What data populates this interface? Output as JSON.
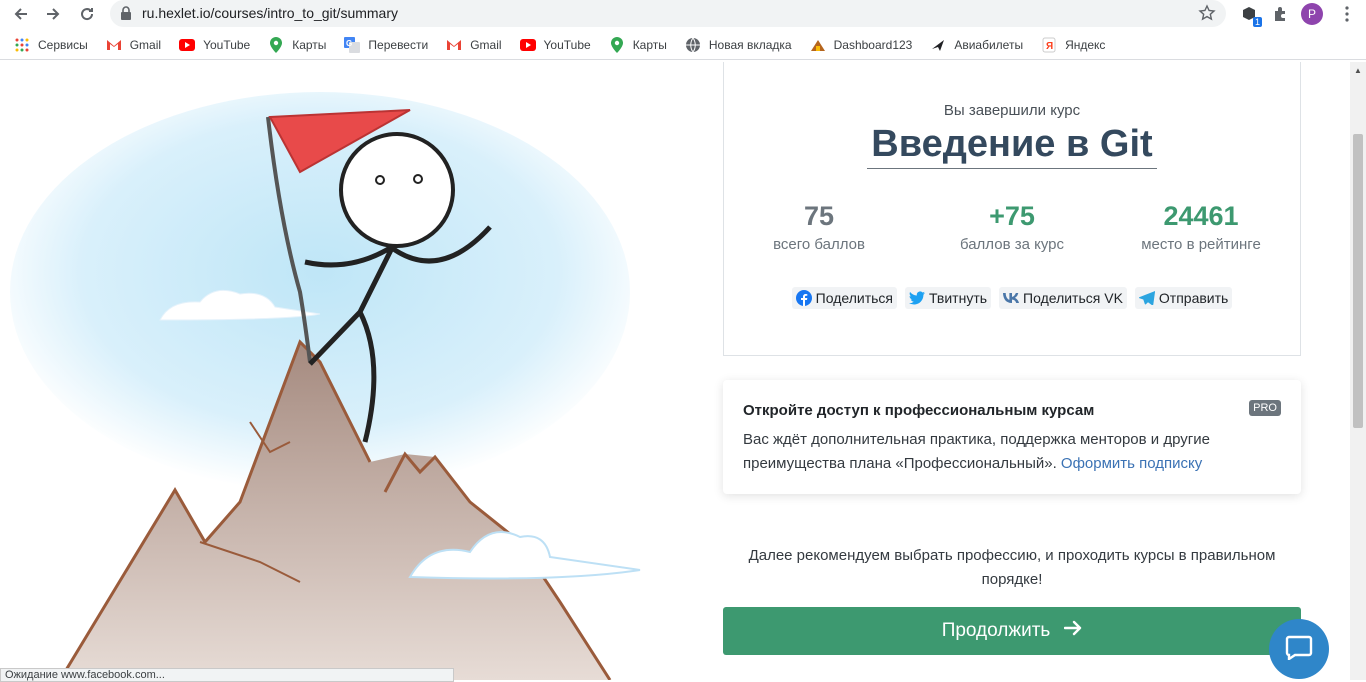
{
  "browser": {
    "url": "ru.hexlet.io/courses/intro_to_git/summary",
    "profile_initial": "P",
    "extension_badge": "1",
    "bookmarks": [
      {
        "label": "Сервисы",
        "icon": "apps-grid-icon"
      },
      {
        "label": "Gmail",
        "icon": "gmail-icon"
      },
      {
        "label": "YouTube",
        "icon": "youtube-icon"
      },
      {
        "label": "Карты",
        "icon": "maps-pin-icon"
      },
      {
        "label": "Перевести",
        "icon": "translate-icon"
      },
      {
        "label": "Gmail",
        "icon": "gmail-icon"
      },
      {
        "label": "YouTube",
        "icon": "youtube-icon"
      },
      {
        "label": "Карты",
        "icon": "maps-pin-icon"
      },
      {
        "label": "Новая вкладка",
        "icon": "globe-icon"
      },
      {
        "label": "Dashboard123",
        "icon": "dashboard-icon"
      },
      {
        "label": "Авиабилеты",
        "icon": "plane-icon"
      },
      {
        "label": "Яндекс",
        "icon": "yandex-icon"
      }
    ],
    "status_text": "Ожидание www.facebook.com..."
  },
  "summary": {
    "completed_label": "Вы завершили курс",
    "course_title": "Введение в Git",
    "stats": [
      {
        "value": "75",
        "label": "всего баллов",
        "color": "#6c757d"
      },
      {
        "value": "+75",
        "label": "баллов за курс",
        "color": "#3d9970"
      },
      {
        "value": "24461",
        "label": "место в рейтинге",
        "color": "#3d9970"
      }
    ],
    "share": [
      {
        "label": "Поделиться",
        "icon": "facebook-icon"
      },
      {
        "label": "Твитнуть",
        "icon": "twitter-icon"
      },
      {
        "label": "Поделиться VK",
        "icon": "vk-icon"
      },
      {
        "label": "Отправить",
        "icon": "telegram-icon"
      }
    ]
  },
  "pro": {
    "title": "Откройте доступ к профессиональным курсам",
    "badge": "PRO",
    "text": "Вас ждёт дополнительная практика, поддержка менторов и другие преимущества плана «Профессиональный».",
    "link": "Оформить подписку"
  },
  "recommend": {
    "text": "Далее рекомендуем выбрать профессию, и проходить курсы в правильном порядке!"
  },
  "continue_button": {
    "label": "Продолжить"
  },
  "colors": {
    "accent_green": "#3d9970",
    "title_dark": "#34495e",
    "link_blue": "#3b72b4",
    "chat_blue": "#2f86c9"
  }
}
